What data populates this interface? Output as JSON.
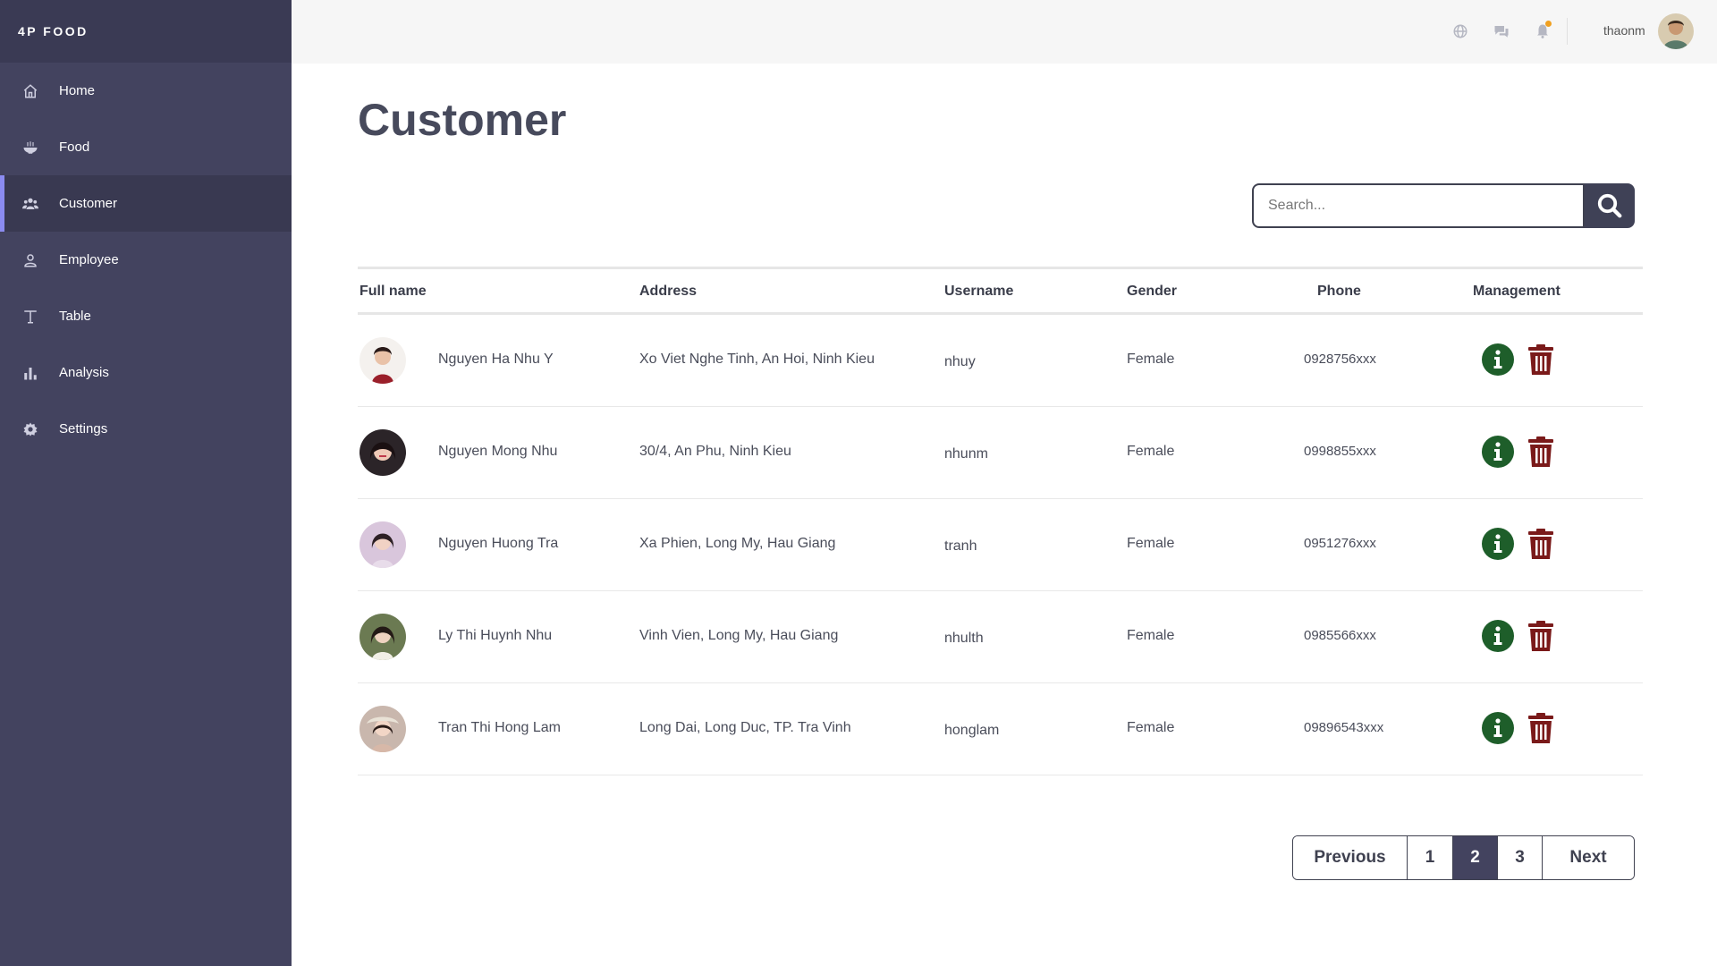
{
  "brand": "4P FOOD",
  "sidebar": {
    "items": [
      {
        "label": "Home",
        "icon": "home-icon"
      },
      {
        "label": "Food",
        "icon": "bowl-icon"
      },
      {
        "label": "Customer",
        "icon": "users-icon",
        "active": true
      },
      {
        "label": "Employee",
        "icon": "user-icon"
      },
      {
        "label": "Table",
        "icon": "table-icon"
      },
      {
        "label": "Analysis",
        "icon": "bar-chart-icon"
      },
      {
        "label": "Settings",
        "icon": "gear-icon"
      }
    ]
  },
  "topbar": {
    "icons": [
      "globe-icon",
      "chat-icon",
      "bell-icon"
    ],
    "username": "thaonm"
  },
  "main": {
    "title": "Customer",
    "search": {
      "placeholder": "Search...",
      "value": ""
    }
  },
  "table": {
    "headers": {
      "full_name": "Full name",
      "address": "Address",
      "username": "Username",
      "gender": "Gender",
      "phone": "Phone",
      "management": "Management"
    },
    "rows": [
      {
        "name": "Nguyen Ha Nhu Y",
        "address": "Xo Viet Nghe Tinh, An Hoi, Ninh Kieu",
        "username": "nhuy",
        "gender": "Female",
        "phone": "0928756xxx"
      },
      {
        "name": "Nguyen Mong Nhu",
        "address": "30/4, An Phu, Ninh Kieu",
        "username": "nhunm",
        "gender": "Female",
        "phone": "0998855xxx"
      },
      {
        "name": "Nguyen Huong Tra",
        "address": "Xa Phien, Long My, Hau Giang",
        "username": "tranh",
        "gender": "Female",
        "phone": "0951276xxx"
      },
      {
        "name": "Ly Thi Huynh Nhu",
        "address": "Vinh Vien, Long My, Hau Giang",
        "username": "nhulth",
        "gender": "Female",
        "phone": "0985566xxx"
      },
      {
        "name": "Tran Thi Hong Lam",
        "address": "Long Dai, Long Duc, TP. Tra Vinh",
        "username": "honglam",
        "gender": "Female",
        "phone": "09896543xxx"
      }
    ]
  },
  "pagination": {
    "previous": "Previous",
    "pages": [
      "1",
      "2",
      "3"
    ],
    "current": "2",
    "next": "Next"
  },
  "colors": {
    "sidebar_bg": "#43435f",
    "active_indicator": "#8b8bf0",
    "info_green": "#1e5e2a",
    "delete_red": "#7a1a1a"
  }
}
